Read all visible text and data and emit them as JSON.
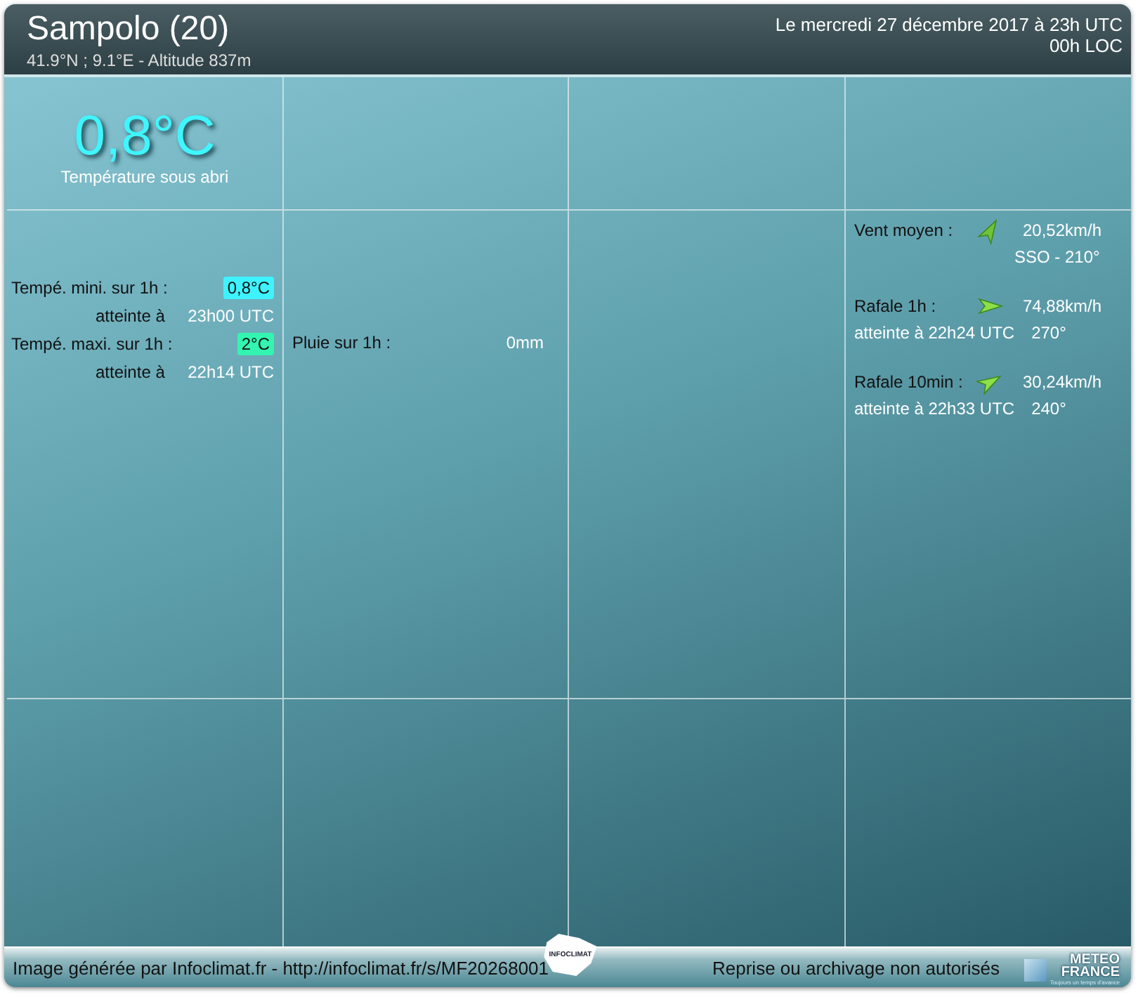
{
  "header": {
    "station": "Sampolo (20)",
    "coordinates": "41.9°N ; 9.1°E - Altitude 837m",
    "date": "Le mercredi 27 décembre 2017 à 23h UTC",
    "local_time": "00h LOC"
  },
  "temperature": {
    "value": "0,8°C",
    "label": "Température sous abri"
  },
  "extremes": [
    {
      "label": "Tempé. mini. sur 1h :",
      "value": "0,8°C",
      "color": "#3ef3ff",
      "reached_label": "atteinte à",
      "reached_time": "23h00 UTC"
    },
    {
      "label": "Tempé. maxi. sur 1h :",
      "value": "2°C",
      "color": "#33f5b0",
      "reached_label": "atteinte à",
      "reached_time": "22h14 UTC"
    }
  ],
  "rain": {
    "label": "Pluie sur 1h :",
    "value": "0mm"
  },
  "wind": [
    {
      "label": "Vent moyen :",
      "speed": "20,52km/h",
      "direction": "SSO - 210°",
      "kind": "mean"
    },
    {
      "label": "Rafale 1h :",
      "speed": "74,88km/h",
      "reached": "atteinte à 22h24 UTC",
      "direction": "270°",
      "kind": "gust"
    },
    {
      "label": "Rafale 10min :",
      "speed": "30,24km/h",
      "reached": "atteinte à 22h33 UTC",
      "direction": "240°",
      "kind": "gust"
    }
  ],
  "footer": {
    "credit": "Image générée par Infoclimat.fr - http://infoclimat.fr/s/MF20268001",
    "notice": "Reprise ou archivage non autorisés",
    "map_logo": "INFOCLIMAT",
    "partner_logo": "METEO FRANCE",
    "partner_tagline": "Toujours un temps d'avance"
  }
}
